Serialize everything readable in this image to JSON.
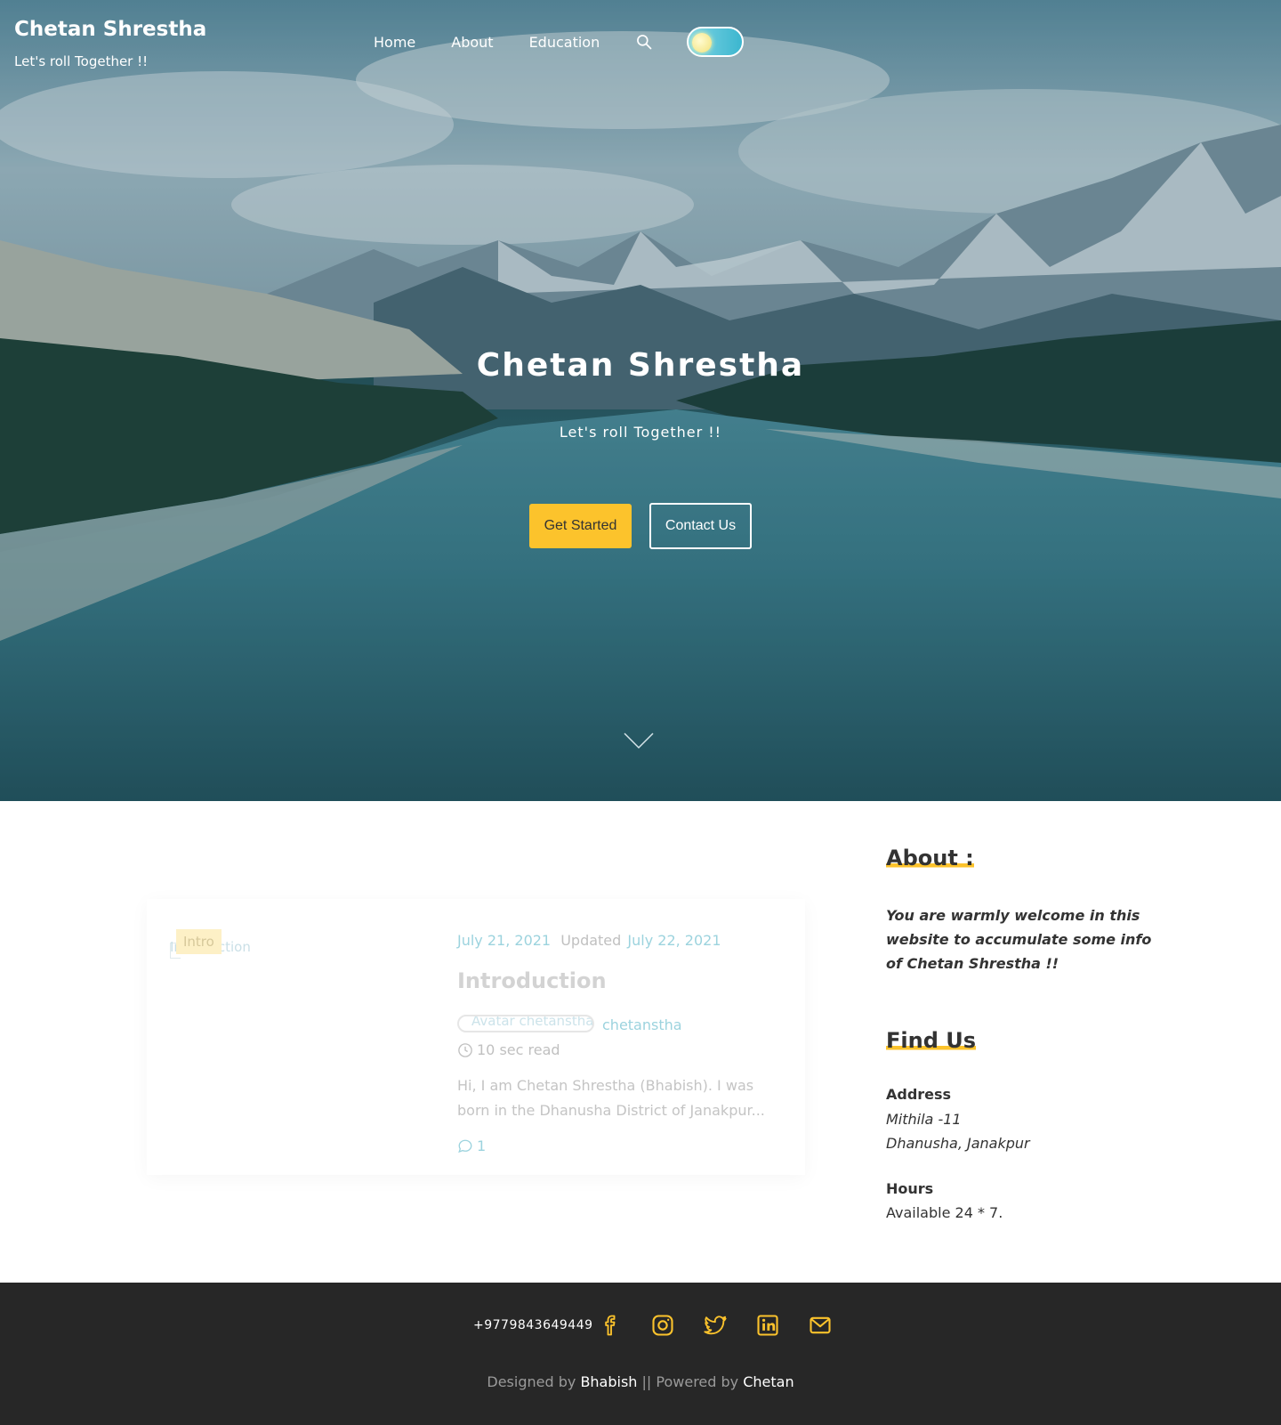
{
  "site": {
    "title": "Chetan Shrestha",
    "tagline": "Let's roll Together !!"
  },
  "nav": {
    "items": [
      {
        "label": "Home"
      },
      {
        "label": "About"
      },
      {
        "label": "Education"
      }
    ],
    "search_icon": "search-icon",
    "theme_toggle": "light-mode"
  },
  "hero": {
    "title": "Chetan Shrestha",
    "subtitle": "Let's roll Together !!",
    "primary_button": "Get Started",
    "secondary_button": "Contact Us",
    "scroll_icon": "chevron-down-icon"
  },
  "post": {
    "category": "Intro",
    "thumbnail_alt": "Introduction",
    "date": "July 21, 2021",
    "updated_label": "Updated",
    "updated_date": "July 22, 2021",
    "title": "Introduction",
    "avatar_alt": "Avatar chetanstha",
    "author": "chetanstha",
    "read_time": "10 sec read",
    "excerpt": "Hi, I am Chetan Shrestha (Bhabish). I was born in the Dhanusha District of Janakpur...",
    "comments_count": "1"
  },
  "sidebar": {
    "about_heading": "About :",
    "about_text": "You are warmly welcome in this website to accumulate some info of Chetan Shrestha !!",
    "find_heading": "Find Us",
    "address_label": "Address",
    "address_line1": "Mithila -11",
    "address_line2": "Dhanusha, Janakpur",
    "hours_label": "Hours",
    "hours_value": "Available 24 * 7."
  },
  "footer": {
    "phone": "+9779843649449",
    "social_icons": [
      "facebook-icon",
      "instagram-icon",
      "twitter-icon",
      "linkedin-icon",
      "mail-icon"
    ],
    "designed_by_label": "Designed by",
    "designer": "Bhabish",
    "separator": "||",
    "powered_by_label": "Powered by",
    "powered_by": "Chetan"
  },
  "colors": {
    "accent": "#fcc32c",
    "link": "#9cd3de",
    "footer_bg": "#272727"
  }
}
